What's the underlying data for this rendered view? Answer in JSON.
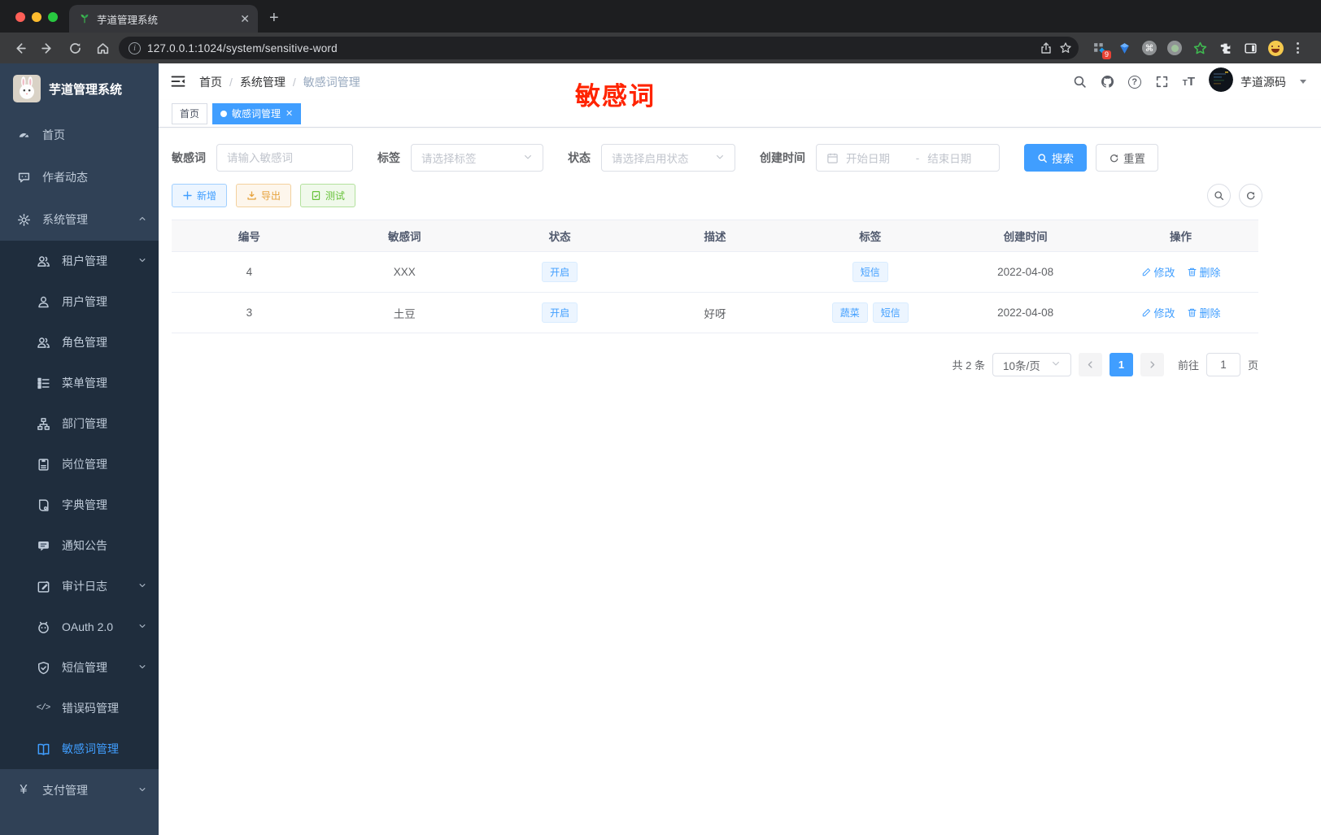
{
  "browser": {
    "tab_title": "芋道管理系统",
    "url": "127.0.0.1:1024/system/sensitive-word",
    "extension_badge": "9"
  },
  "annotation": {
    "text": "敏感词"
  },
  "sidebar": {
    "app_title": "芋道管理系统",
    "menu": [
      {
        "label": "首页",
        "icon": "dashboard-icon",
        "level": 1
      },
      {
        "label": "作者动态",
        "icon": "chat-icon",
        "level": 1
      },
      {
        "label": "系统管理",
        "icon": "gear-icon",
        "level": 1,
        "chevron": "up"
      },
      {
        "label": "租户管理",
        "icon": "users-icon",
        "level": 2,
        "chevron": "down"
      },
      {
        "label": "用户管理",
        "icon": "user-icon",
        "level": 2
      },
      {
        "label": "角色管理",
        "icon": "users-icon",
        "level": 2
      },
      {
        "label": "菜单管理",
        "icon": "menu-tree-icon",
        "level": 2
      },
      {
        "label": "部门管理",
        "icon": "org-icon",
        "level": 2
      },
      {
        "label": "岗位管理",
        "icon": "badge-icon",
        "level": 2
      },
      {
        "label": "字典管理",
        "icon": "dict-icon",
        "level": 2
      },
      {
        "label": "通知公告",
        "icon": "notice-icon",
        "level": 2
      },
      {
        "label": "审计日志",
        "icon": "log-icon",
        "level": 2,
        "chevron": "down"
      },
      {
        "label": "OAuth 2.0",
        "icon": "oauth-icon",
        "level": 2,
        "chevron": "down"
      },
      {
        "label": "短信管理",
        "icon": "shield-icon",
        "level": 2,
        "chevron": "down"
      },
      {
        "label": "错误码管理",
        "icon": "code-icon",
        "level": 2
      },
      {
        "label": "敏感词管理",
        "icon": "book-icon",
        "level": 2,
        "active": true
      },
      {
        "label": "支付管理",
        "icon": "yen-icon",
        "level": 1,
        "chevron": "down"
      }
    ]
  },
  "header": {
    "breadcrumb": [
      "首页",
      "系统管理",
      "敏感词管理"
    ],
    "username": "芋道源码"
  },
  "tabs": [
    {
      "label": "首页",
      "active": false
    },
    {
      "label": "敏感词管理",
      "active": true
    }
  ],
  "filters": {
    "keyword": {
      "label": "敏感词",
      "placeholder": "请输入敏感词"
    },
    "tag": {
      "label": "标签",
      "placeholder": "请选择标签"
    },
    "status": {
      "label": "状态",
      "placeholder": "请选择启用状态"
    },
    "create_time": {
      "label": "创建时间",
      "start_placeholder": "开始日期",
      "separator": "-",
      "end_placeholder": "结束日期"
    },
    "search_label": "搜索",
    "reset_label": "重置"
  },
  "toolbar": {
    "add_label": "新增",
    "export_label": "导出",
    "test_label": "测试"
  },
  "table": {
    "columns": [
      "编号",
      "敏感词",
      "状态",
      "描述",
      "标签",
      "创建时间",
      "操作"
    ],
    "rows": [
      {
        "id": "4",
        "word": "XXX",
        "status": "开启",
        "description": "",
        "tags": [
          "短信"
        ],
        "create_time": "2022-04-08"
      },
      {
        "id": "3",
        "word": "土豆",
        "status": "开启",
        "description": "好呀",
        "tags": [
          "蔬菜",
          "短信"
        ],
        "create_time": "2022-04-08"
      }
    ],
    "edit_label": "修改",
    "delete_label": "删除"
  },
  "pagination": {
    "total_text": "共 2 条",
    "page_size": "10条/页",
    "current_page": "1",
    "goto_label": "前往",
    "goto_value": "1",
    "unit_label": "页"
  },
  "colors": {
    "accent": "#409eff",
    "warning": "#e6a23c",
    "success": "#67c23a",
    "annotation_red": "#ff2400",
    "sidebar_bg": "#304156",
    "submenu_bg": "#1f2d3d"
  }
}
